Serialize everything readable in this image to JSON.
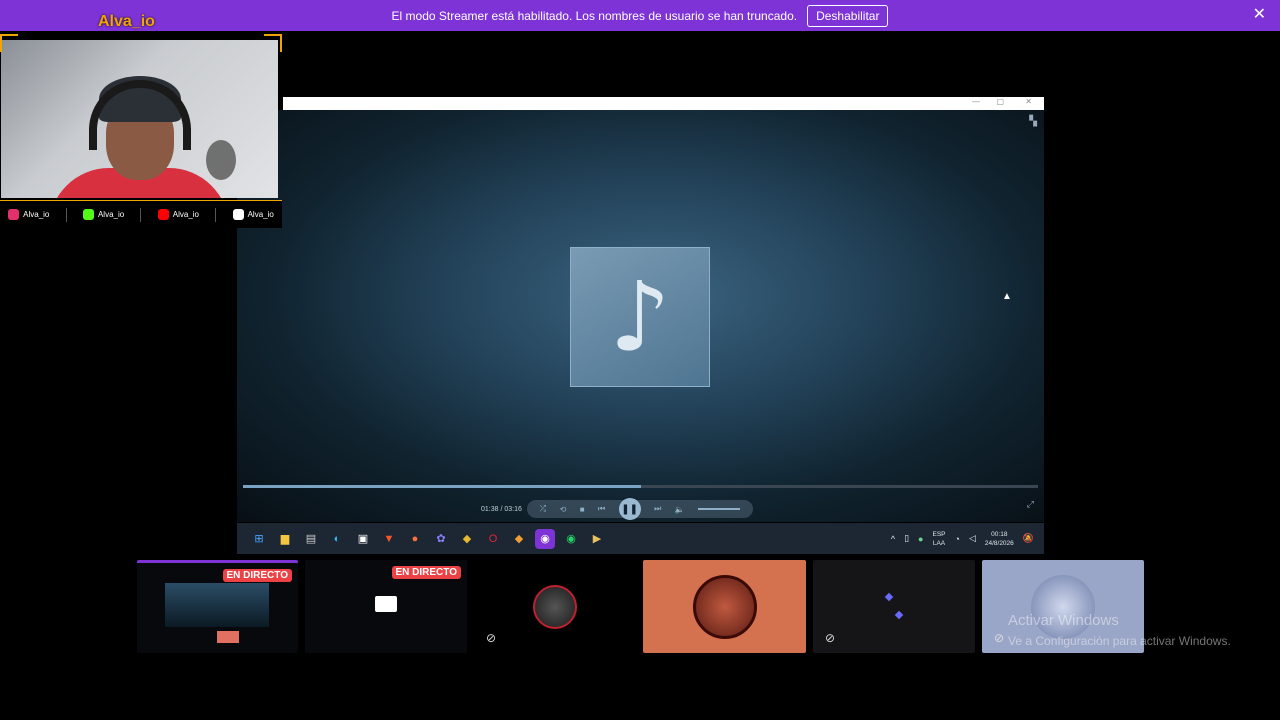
{
  "banner": {
    "message": "El modo Streamer está habilitado. Los nombres de usuario se han truncado.",
    "disable_label": "Deshabilitar",
    "close_glyph": "✕"
  },
  "webcam": {
    "streamer_name": "Alva_io",
    "socials": [
      {
        "icon": "instagram-icon",
        "label": "Alva_io",
        "color": "#e1306c"
      },
      {
        "icon": "kick-icon",
        "label": "Alva_io",
        "color": "#53fc18"
      },
      {
        "icon": "youtube-icon",
        "label": "Alva_io",
        "color": "#ff0000"
      },
      {
        "icon": "tiktok-icon",
        "label": "Alva_io",
        "color": "#ffffff"
      }
    ]
  },
  "player": {
    "time": "01:38 / 03:16",
    "progress_fraction": 0.5,
    "volume_fraction": 0.8,
    "note_glyph": "♪",
    "play_glyph": "❚❚"
  },
  "taskbar": {
    "apps": [
      {
        "name": "start-icon",
        "glyph": "⊞",
        "color": "#4aa3ff"
      },
      {
        "name": "file-explorer-icon",
        "glyph": "▆",
        "color": "#f4c542"
      },
      {
        "name": "terminal-icon",
        "glyph": "▤",
        "color": "#cccccc"
      },
      {
        "name": "edge-icon",
        "glyph": "◐",
        "color": "#35b6e8"
      },
      {
        "name": "store-icon",
        "glyph": "▣",
        "color": "#ffffff"
      },
      {
        "name": "brave-icon",
        "glyph": "▼",
        "color": "#fb542b"
      },
      {
        "name": "firefox-icon",
        "glyph": "●",
        "color": "#ff7139"
      },
      {
        "name": "copilot-icon",
        "glyph": "✿",
        "color": "#8a7dff"
      },
      {
        "name": "bitdefender-icon",
        "glyph": "◆",
        "color": "#e8b930"
      },
      {
        "name": "opera-icon",
        "glyph": "O",
        "color": "#e0243a"
      },
      {
        "name": "shield-app-icon",
        "glyph": "◆",
        "color": "#f0a030"
      },
      {
        "name": "discord-icon",
        "glyph": "◉",
        "color": "#ffffff"
      },
      {
        "name": "whatsapp-icon",
        "glyph": "◉",
        "color": "#25d366"
      },
      {
        "name": "media-player-icon",
        "glyph": "▶",
        "color": "#e8c060"
      }
    ],
    "lang_line1": "ESP",
    "lang_line2": "LAA",
    "clock_time": "00:18",
    "clock_date": "24/8/2026"
  },
  "tiles": {
    "live_label": "EN DIRECTO",
    "mute_glyph": "⊘"
  },
  "watermark": {
    "line1": "Activar Windows",
    "line2": "Ve a Configuración para activar Windows."
  }
}
